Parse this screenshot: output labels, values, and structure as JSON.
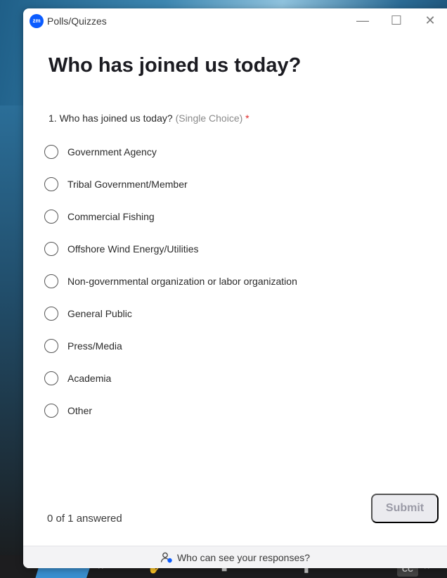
{
  "window": {
    "app_logo_text": "zm",
    "title": "Polls/Quizzes",
    "controls": {
      "minimize": "—",
      "maximize": "☐",
      "close": "✕"
    }
  },
  "poll": {
    "heading": "Who has joined us today?",
    "question": {
      "number_text": "1. Who has joined us today?",
      "type_text": "(Single Choice)",
      "required_mark": "*"
    },
    "options": [
      "Government Agency",
      "Tribal Government/Member",
      "Commercial Fishing",
      "Offshore Wind Energy/Utilities",
      "Non-governmental organization or labor organization",
      "General Public",
      "Press/Media",
      "Academia",
      "Other"
    ]
  },
  "footer": {
    "answered_text": "0 of 1 answered",
    "submit_label": "Submit",
    "privacy_link": "Who can see your responses?"
  },
  "taskbar": {
    "cc_label": "CC"
  },
  "colors": {
    "accent": "#0b5cff",
    "required": "#e02828",
    "submit_disabled_bg": "#ebebef"
  }
}
